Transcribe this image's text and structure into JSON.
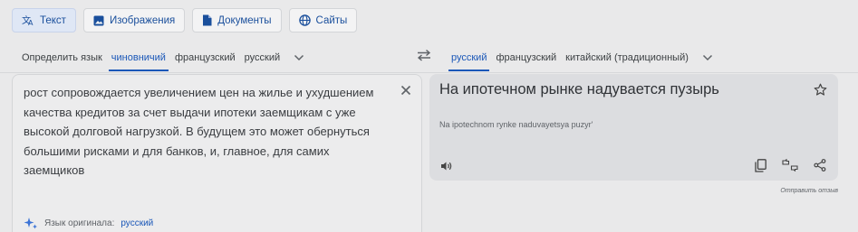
{
  "modes": {
    "text": "Текст",
    "images": "Изображения",
    "documents": "Документы",
    "sites": "Сайты"
  },
  "source_langs": {
    "detect": "Определить язык",
    "l1": "чиновничий",
    "l2": "французский",
    "l3": "русский"
  },
  "target_langs": {
    "l1": "русский",
    "l2": "французский",
    "l3": "китайский (традиционный)"
  },
  "source": {
    "text": "рост сопровождается увеличением цен на жилье и ухудшением качества кредитов за счет выдачи ипотеки заемщикам с уже высокой долговой нагрузкой. В будущем это может обернуться большими рисками и для банков, и, главное, для самих заемщиков",
    "detected_label": "Язык оригинала:",
    "detected_lang": "русский"
  },
  "target": {
    "text": "На ипотечном рынке надувается пузырь",
    "transliteration": "Na ipotechnom rynke naduvayetsya puzyr'"
  },
  "feedback": "Отправить отзыв",
  "colors": {
    "accent": "#1a57b8",
    "background": "#e9e9ea",
    "target_panel": "#dcdde0"
  }
}
